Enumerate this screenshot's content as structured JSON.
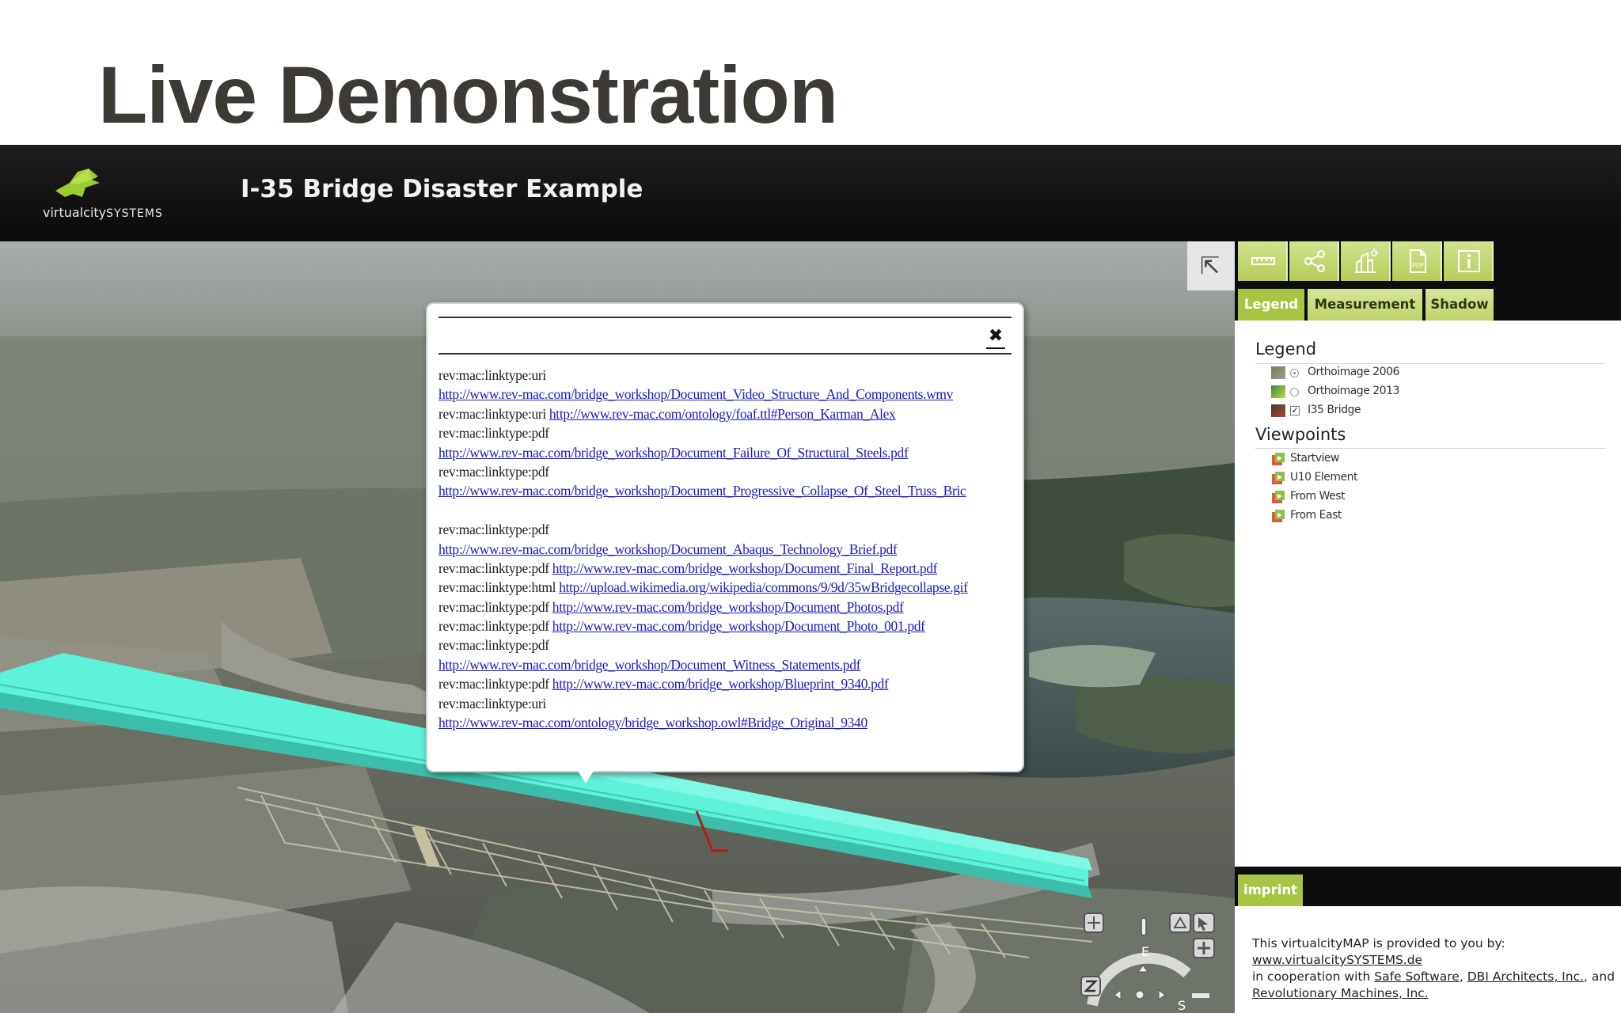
{
  "slide": {
    "title": "Live Demonstration"
  },
  "header": {
    "logo_text_a": "virtualcity",
    "logo_text_b": "SYSTEMS",
    "title": "I-35 Bridge Disaster Example"
  },
  "popup": {
    "close_glyph": "✖",
    "lines": [
      {
        "prefix": "rev:mac:linktype:uri",
        "link": ""
      },
      {
        "prefix": "",
        "link": "http://www.rev-mac.com/bridge_workshop/Document_Video_Structure_And_Components.wmv"
      },
      {
        "prefix": "rev:mac:linktype:uri",
        "link": "http://www.rev-mac.com/ontology/foaf.ttl#Person_Karman_Alex"
      },
      {
        "prefix": "rev:mac:linktype:pdf",
        "link": ""
      },
      {
        "prefix": "",
        "link": "http://www.rev-mac.com/bridge_workshop/Document_Failure_Of_Structural_Steels.pdf"
      },
      {
        "prefix": "rev:mac:linktype:pdf",
        "link": ""
      },
      {
        "prefix": "",
        "link": "http://www.rev-mac.com/bridge_workshop/Document_Progressive_Collapse_Of_Steel_Truss_Bric"
      },
      {
        "prefix": "",
        "link": ""
      },
      {
        "prefix": "rev:mac:linktype:pdf",
        "link": ""
      },
      {
        "prefix": "",
        "link": "http://www.rev-mac.com/bridge_workshop/Document_Abaqus_Technology_Brief.pdf"
      },
      {
        "prefix": "rev:mac:linktype:pdf",
        "link": "http://www.rev-mac.com/bridge_workshop/Document_Final_Report.pdf"
      },
      {
        "prefix": "rev:mac:linktype:html",
        "link": "http://upload.wikimedia.org/wikipedia/commons/9/9d/35wBridgecollapse.gif"
      },
      {
        "prefix": "rev:mac:linktype:pdf",
        "link": "http://www.rev-mac.com/bridge_workshop/Document_Photos.pdf"
      },
      {
        "prefix": "rev:mac:linktype:pdf",
        "link": "http://www.rev-mac.com/bridge_workshop/Document_Photo_001.pdf"
      },
      {
        "prefix": "rev:mac:linktype:pdf",
        "link": ""
      },
      {
        "prefix": "",
        "link": "http://www.rev-mac.com/bridge_workshop/Document_Witness_Statements.pdf"
      },
      {
        "prefix": "rev:mac:linktype:pdf",
        "link": "http://www.rev-mac.com/bridge_workshop/Blueprint_9340.pdf"
      },
      {
        "prefix": "rev:mac:linktype:uri",
        "link": ""
      },
      {
        "prefix": "",
        "link": "http://www.rev-mac.com/ontology/bridge_workshop.owl#Bridge_Original_9340"
      }
    ]
  },
  "toolbar": {
    "icons": [
      "measure-ruler-icon",
      "share-icon",
      "shadow-building-icon",
      "pdf-icon",
      "info-icon"
    ],
    "accent": "#a8c443"
  },
  "tabs": {
    "legend": "Legend",
    "measurement": "Measurement",
    "shadow": "Shadow"
  },
  "legend": {
    "title": "Legend",
    "items": [
      {
        "label": "Orthoimage 2006",
        "control": "radio",
        "checked": true
      },
      {
        "label": "Orthoimage 2013",
        "control": "radio",
        "checked": false
      },
      {
        "label": "I35 Bridge",
        "control": "checkbox",
        "checked": true
      }
    ]
  },
  "viewpoints": {
    "title": "Viewpoints",
    "items": [
      "Startview",
      "U10 Element",
      "From West",
      "From East"
    ]
  },
  "imprint": {
    "tab": "imprint",
    "line1": "This virtualcityMAP is provided to you by:",
    "link1": "www.virtualcitySYSTEMS.de",
    "line2_prefix": "in cooperation with ",
    "link2": "Safe Software",
    "sep1": ", ",
    "link3": "DBI Architects, Inc.",
    "sep2": ", and ",
    "link4": "Revolutionary Machines, Inc."
  },
  "nav": {
    "compass_e": "E",
    "compass_s": "S",
    "zoom_in": "+",
    "zoom_out": "−"
  },
  "colors": {
    "bridge": "#5ef2d8",
    "header_bg": "#0d0d0d",
    "link": "#1a1ac9"
  }
}
